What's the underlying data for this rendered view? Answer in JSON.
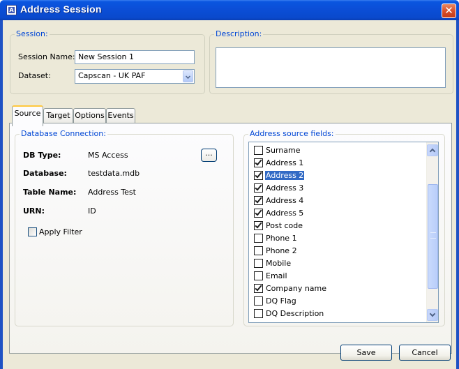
{
  "window": {
    "title": "Address Session",
    "app_icon_letter": "A",
    "close_glyph": "✕"
  },
  "session": {
    "group_title": "Session:",
    "name_label": "Session Name:",
    "name_value": "New Session 1",
    "dataset_label": "Dataset:",
    "dataset_value": "Capscan - UK PAF"
  },
  "description": {
    "group_title": "Description:",
    "value": ""
  },
  "tabs": [
    {
      "label": "Source",
      "active": true
    },
    {
      "label": "Target",
      "active": false
    },
    {
      "label": "Options",
      "active": false
    },
    {
      "label": "Events",
      "active": false
    }
  ],
  "db_connection": {
    "group_title": "Database Connection:",
    "rows": [
      {
        "label": "DB Type:",
        "value": "MS Access"
      },
      {
        "label": "Database:",
        "value": "testdata.mdb"
      },
      {
        "label": "Table Name:",
        "value": "Address Test"
      },
      {
        "label": "URN:",
        "value": "ID"
      }
    ],
    "browse_label": "...",
    "apply_filter_label": "Apply Filter",
    "apply_filter_checked": false
  },
  "address_fields": {
    "group_title": "Address source fields:",
    "items": [
      {
        "label": "Surname",
        "checked": false,
        "selected": false
      },
      {
        "label": "Address 1",
        "checked": true,
        "selected": false
      },
      {
        "label": "Address 2",
        "checked": true,
        "selected": true
      },
      {
        "label": "Address 3",
        "checked": true,
        "selected": false
      },
      {
        "label": "Address 4",
        "checked": true,
        "selected": false
      },
      {
        "label": "Address 5",
        "checked": true,
        "selected": false
      },
      {
        "label": "Post code",
        "checked": true,
        "selected": false
      },
      {
        "label": "Phone 1",
        "checked": false,
        "selected": false
      },
      {
        "label": "Phone 2",
        "checked": false,
        "selected": false
      },
      {
        "label": "Mobile",
        "checked": false,
        "selected": false
      },
      {
        "label": "Email",
        "checked": false,
        "selected": false
      },
      {
        "label": "Company name",
        "checked": true,
        "selected": false
      },
      {
        "label": "DQ Flag",
        "checked": false,
        "selected": false
      },
      {
        "label": "DQ Description",
        "checked": false,
        "selected": false
      }
    ]
  },
  "footer": {
    "save_label": "Save",
    "cancel_label": "Cancel"
  },
  "colors": {
    "titlebar": "#0a49cc",
    "group_title": "#0046d5",
    "selection": "#316ac5",
    "close": "#d9502b"
  }
}
